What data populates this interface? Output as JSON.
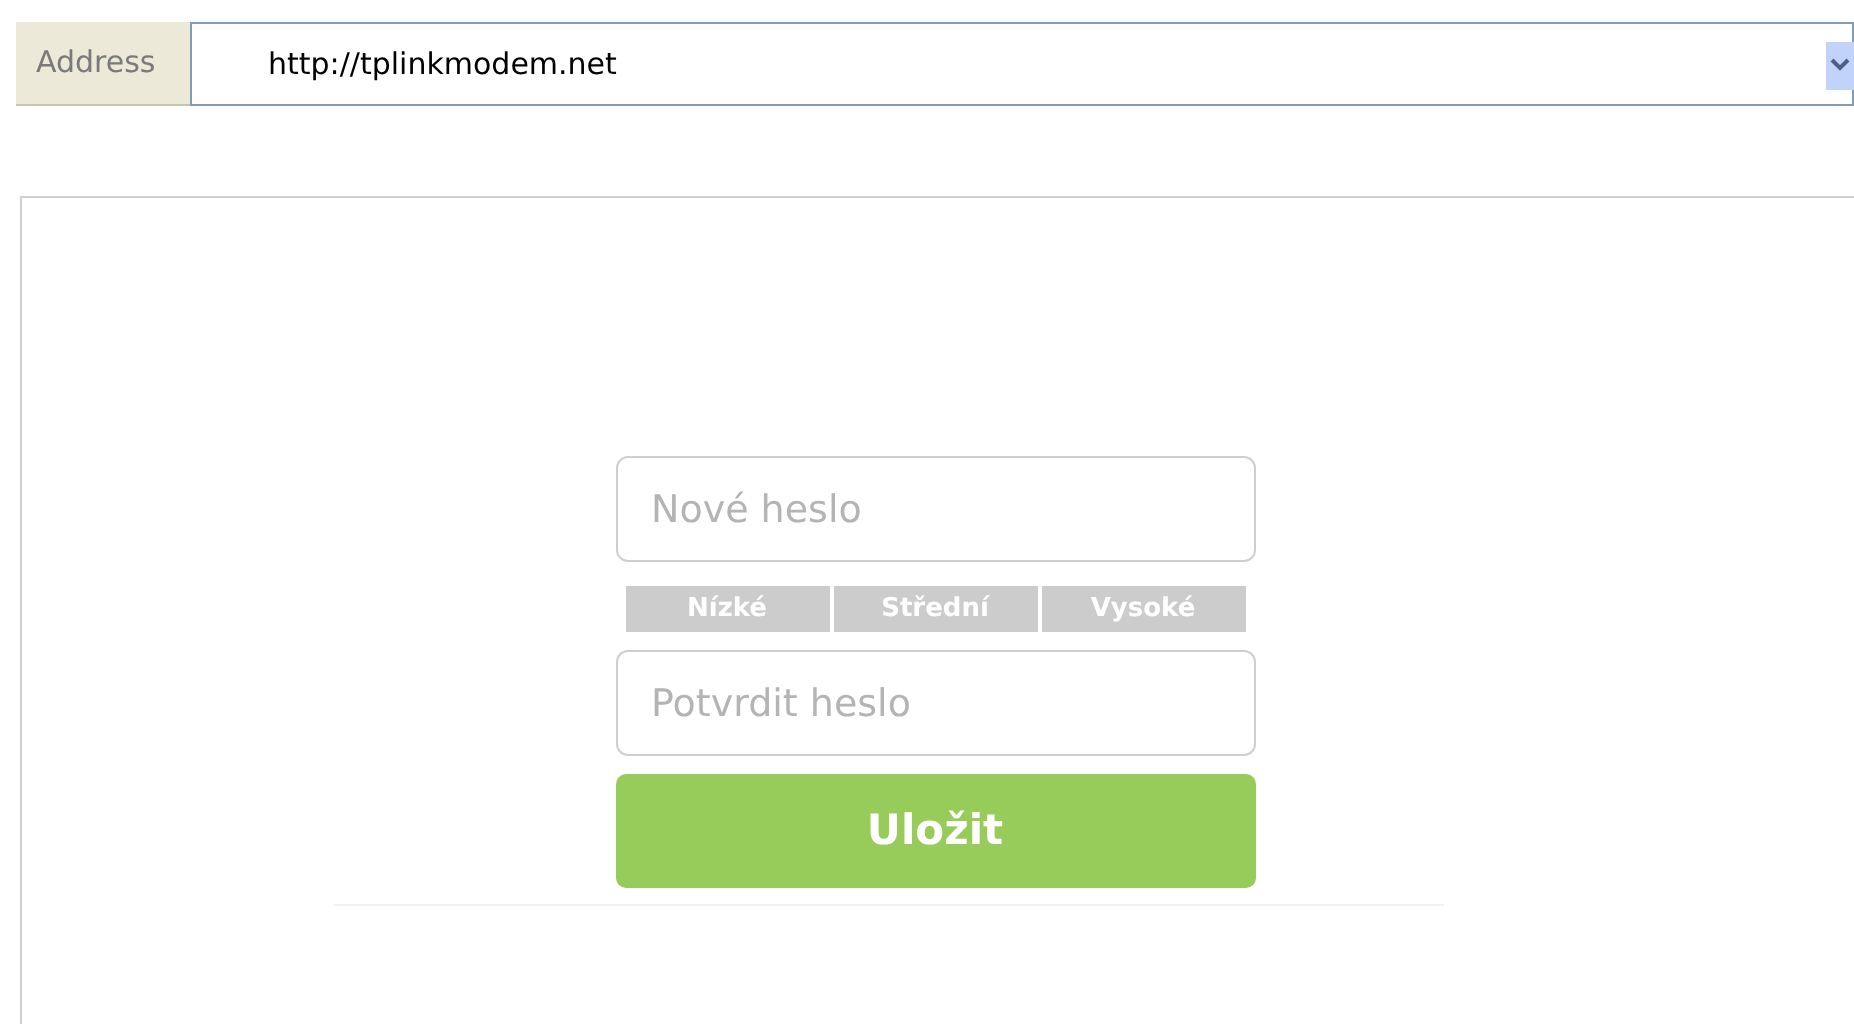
{
  "address_bar": {
    "label": "Address",
    "url": "http://tplinkmodem.net"
  },
  "form": {
    "new_password": {
      "placeholder": "Nové heslo"
    },
    "strength_levels": [
      "Nízké",
      "Střední",
      "Vysoké"
    ],
    "confirm_password": {
      "placeholder": "Potvrdit heslo"
    },
    "save_button": "Uložit"
  }
}
